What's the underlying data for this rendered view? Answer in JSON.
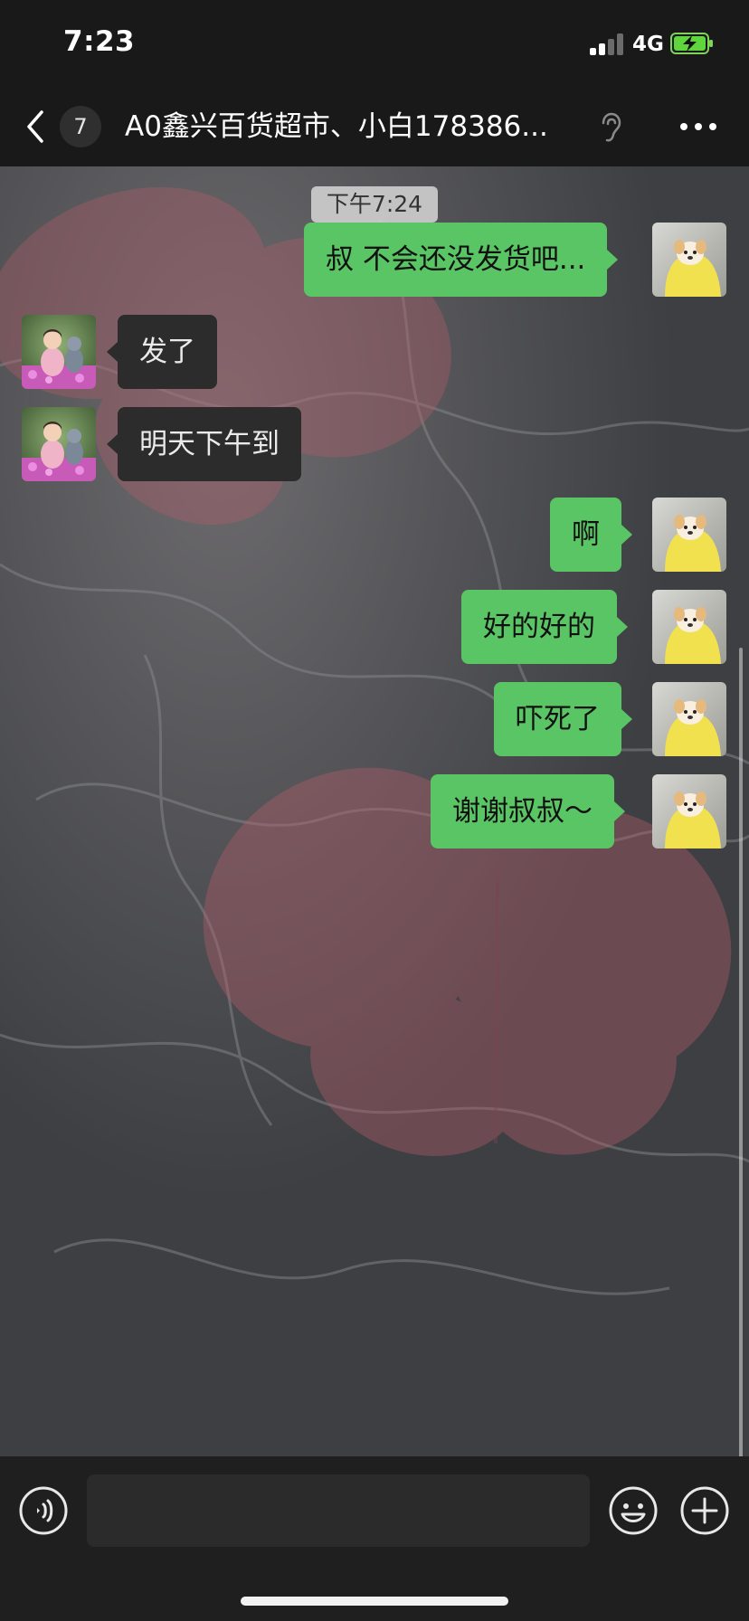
{
  "status_bar": {
    "time": "7:23",
    "network": "4G",
    "signal_icon": "signal-bars-icon",
    "battery_icon": "battery-charging-icon"
  },
  "nav": {
    "back_icon": "chevron-left-icon",
    "unread_count": "7",
    "title": "A0鑫兴百货超市、小白178386...",
    "ear_icon": "ear-icon",
    "more_icon": "more-dots-icon"
  },
  "chat": {
    "timestamp": "下午7:24",
    "messages": [
      {
        "direction": "out",
        "text": "叔 不会还没发货吧..."
      },
      {
        "direction": "in",
        "text": "发了"
      },
      {
        "direction": "in",
        "text": "明天下午到"
      },
      {
        "direction": "out",
        "text": "啊"
      },
      {
        "direction": "out",
        "text": "好的好的"
      },
      {
        "direction": "out",
        "text": "吓死了"
      },
      {
        "direction": "out",
        "text": "谢谢叔叔～"
      }
    ]
  },
  "input_bar": {
    "voice_icon": "voice-icon",
    "input_value": "",
    "emoji_icon": "emoji-icon",
    "add_icon": "plus-circle-icon"
  },
  "colors": {
    "outgoing_bubble": "#5ac564",
    "incoming_bubble": "#2c2c2c",
    "bar_background": "#191919"
  }
}
